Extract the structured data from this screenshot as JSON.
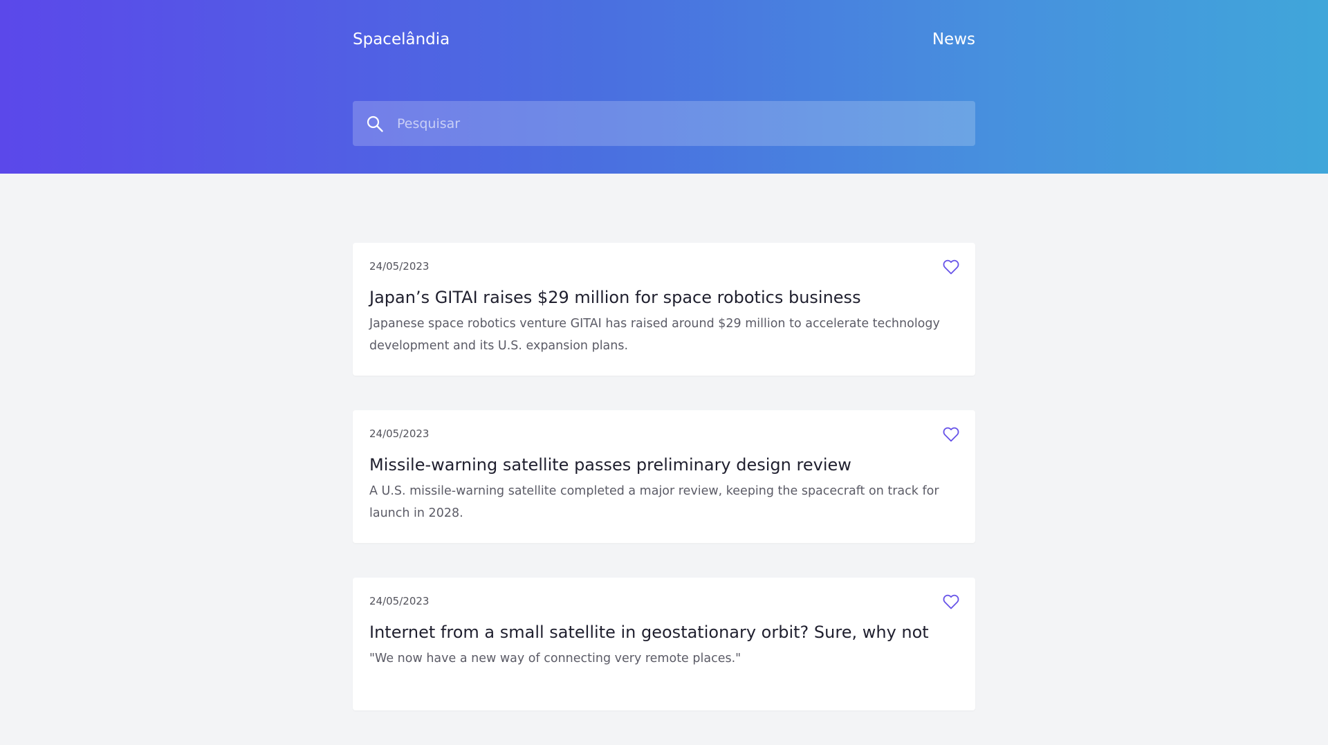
{
  "header": {
    "brand": "Spacelândia",
    "nav_link": "News",
    "search": {
      "placeholder": "Pesquisar",
      "icon": "search-icon"
    }
  },
  "colors": {
    "gradient_start": "#5b48ea",
    "gradient_end": "#40a6da",
    "accent": "#6652e8",
    "background": "#f3f4f6"
  },
  "articles": [
    {
      "date": "24/05/2023",
      "title": "Japan’s GITAI raises $29 million for space robotics business",
      "description": "Japanese space robotics venture GITAI has raised around $29 million to accelerate technology development and its U.S. expansion plans.",
      "icon": "heart-icon"
    },
    {
      "date": "24/05/2023",
      "title": "Missile-warning satellite passes preliminary design review",
      "description": "A U.S. missile-warning satellite completed a major review, keeping the spacecraft on track for launch in 2028.",
      "icon": "heart-icon"
    },
    {
      "date": "24/05/2023",
      "title": "Internet from a small satellite in geostationary orbit? Sure, why not",
      "description": "\"We now have a new way of connecting very remote places.\"",
      "icon": "heart-icon"
    }
  ]
}
